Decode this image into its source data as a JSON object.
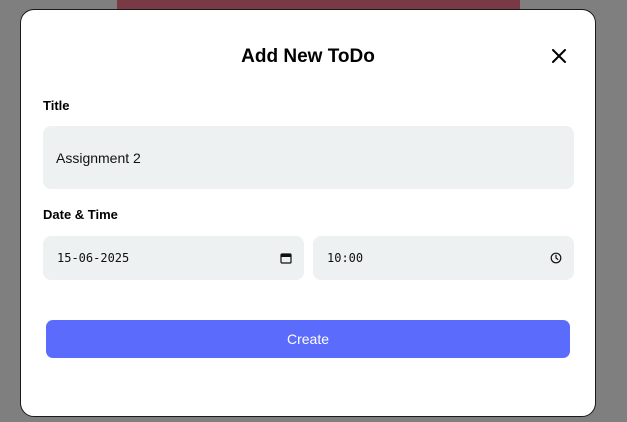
{
  "modal": {
    "title": "Add New ToDo",
    "close_icon": "close-icon"
  },
  "form": {
    "title_label": "Title",
    "title_value": "Assignment 2",
    "datetime_label": "Date & Time",
    "date_value": "15-06-2025",
    "date_icon": "calendar-icon",
    "time_value": "10:00",
    "time_icon": "clock-icon",
    "submit_label": "Create"
  },
  "colors": {
    "backdrop": "#7f7f7f",
    "background_accent": "#7a3a45",
    "input_bg": "#eef1f2",
    "primary_button": "#5b6bfb"
  }
}
